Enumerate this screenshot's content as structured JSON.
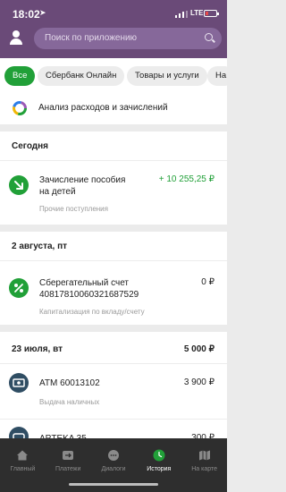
{
  "status_bar": {
    "time": "18:02",
    "network": "LTE"
  },
  "search": {
    "placeholder": "Поиск по приложению"
  },
  "filters": [
    "Все",
    "Сбербанк Онлайн",
    "Товары и услуги",
    "На"
  ],
  "analysis": {
    "label": "Анализ расходов и зачислений"
  },
  "sections": [
    {
      "title": "Сегодня",
      "total": "",
      "transactions": [
        {
          "title": "Зачисление пособия на детей",
          "amount": "+ 10 255,25 ₽",
          "category": "Прочие поступления",
          "icon": "arrow-down-right-icon",
          "color": "#21a038"
        }
      ]
    },
    {
      "title": "2 августа, пт",
      "total": "",
      "transactions": [
        {
          "title": "Сберегательный счет 40817810060321687529",
          "amount": "0 ₽",
          "category": "Капитализация по вкладу/счету",
          "icon": "percent-icon",
          "color": "#222222"
        }
      ]
    },
    {
      "title": "23 июля, вт",
      "total": "5 000 ₽",
      "transactions": [
        {
          "title": "ATM 60013102",
          "amount": "3 900 ₽",
          "category": "Выдача наличных",
          "icon": "cash-icon",
          "color": "#222222"
        },
        {
          "title": "APTEKA 35",
          "amount": "300 ₽",
          "category": "",
          "icon": "car-icon",
          "color": "#222222"
        }
      ]
    }
  ],
  "tabbar": [
    {
      "label": "Главный",
      "icon": "home-icon",
      "active": false
    },
    {
      "label": "Платежи",
      "icon": "payments-icon",
      "active": false
    },
    {
      "label": "Диалоги",
      "icon": "chat-icon",
      "active": false
    },
    {
      "label": "История",
      "icon": "clock-icon",
      "active": true
    },
    {
      "label": "На карте",
      "icon": "map-icon",
      "active": false
    }
  ],
  "colors": {
    "header": "#6a4a78",
    "accent": "#21a038",
    "tabbar": "#2e2e2e"
  }
}
